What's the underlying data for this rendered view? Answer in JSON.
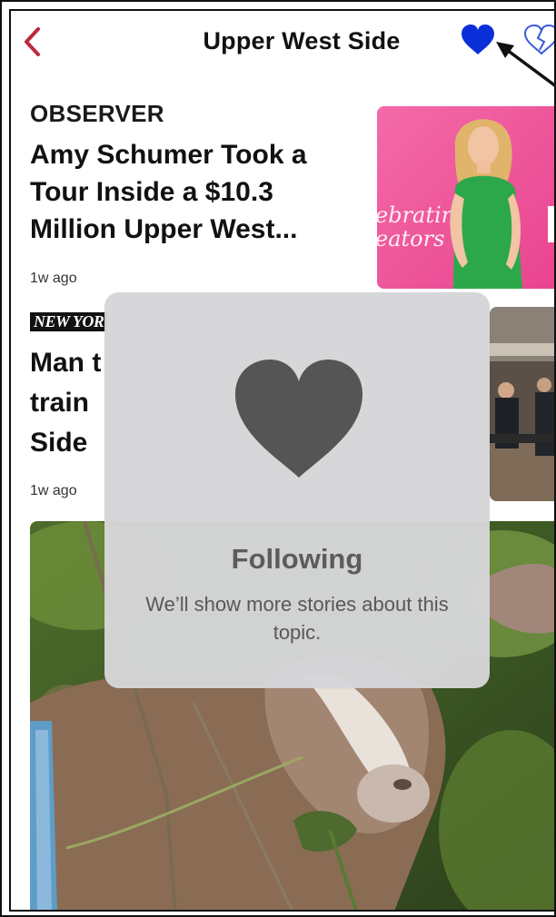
{
  "header": {
    "title": "Upper West Side",
    "back_icon": "chevron-left-icon",
    "follow_icon": "heart-filled-icon",
    "block_icon": "heart-broken-icon"
  },
  "articles": [
    {
      "source": "OBSERVER",
      "headline": "Amy Schumer Took a Tour Inside a $10.3 Million Upper West...",
      "time": "1w ago"
    },
    {
      "source": "NEW YOR",
      "headline": "Man t train Side",
      "headline_lines": [
        "Man t",
        "train",
        "Side"
      ],
      "time": "1w ago"
    }
  ],
  "toast": {
    "icon": "heart-icon",
    "title": "Following",
    "message": "We’ll show more stories about this topic."
  },
  "thumbnail_text": {
    "banner": "ebratin",
    "banner2": "eators"
  },
  "colors": {
    "back_chevron": "#c0283a",
    "follow_heart": "#0a2fd8",
    "toast_bg": "#d6d6d8",
    "toast_icon": "#555555",
    "thumb_pink": "#f0539a",
    "dress_green": "#2ca84a"
  }
}
